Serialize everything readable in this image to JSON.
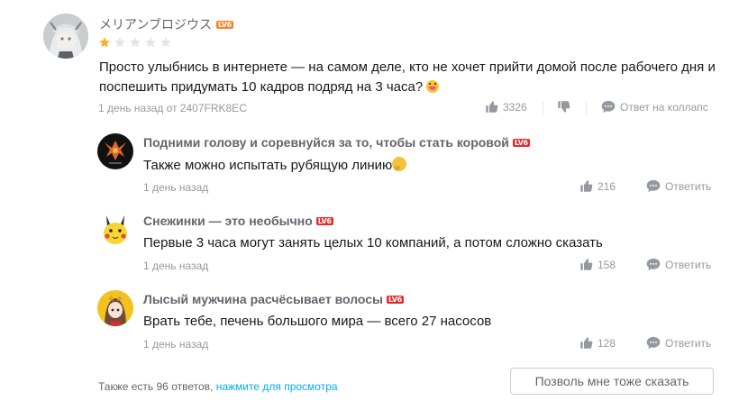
{
  "main_comment": {
    "username": "メリアンブロジウス",
    "level_badge": "LV6",
    "rating": {
      "stars_filled": 1,
      "stars_total": 5
    },
    "text": "Просто улыбнись в интернете — на самом деле, кто не хочет прийти домой после рабочего дня и поспешить придумать 10 кадров подряд на 3 часа?",
    "emoji_icon": "grinning-face-emoji",
    "meta": "1 день назад от 2407FRK8EC",
    "likes": "3326",
    "reply_label": "Ответ на коллапс"
  },
  "replies": [
    {
      "username": "Подними голову и соревнуйся за то, чтобы стать коровой",
      "level_badge": "LV6",
      "text": "Также можно испытать рубящую линию",
      "emoji_icon": "thinking-face-emoji",
      "time": "1 день назад",
      "likes": "216",
      "reply_label": "Ответить"
    },
    {
      "username": "Снежинки — это необычно",
      "level_badge": "LV6",
      "text": "Первые 3 часа могут занять целых 10 компаний, а потом сложно сказать",
      "time": "1 день назад",
      "likes": "158",
      "reply_label": "Ответить"
    },
    {
      "username": "Лысый мужчина расчёсывает волосы",
      "level_badge": "LV6",
      "text": "Врать тебе, печень большого мира — всего 27 насосов",
      "time": "1 день назад",
      "likes": "128",
      "reply_label": "Ответить"
    }
  ],
  "footer": {
    "more_prefix": "Также есть 96 ответов,",
    "more_link": "нажмите для просмотра",
    "say_button": "Позволь мне тоже сказать"
  },
  "colors": {
    "level_badge_main": "#ff7f24",
    "level_badge_reply": "#e52b2b",
    "star_filled": "#ffb027",
    "star_empty": "#e3e5e7",
    "link": "#00aeec",
    "meta_text": "#9499a0"
  }
}
